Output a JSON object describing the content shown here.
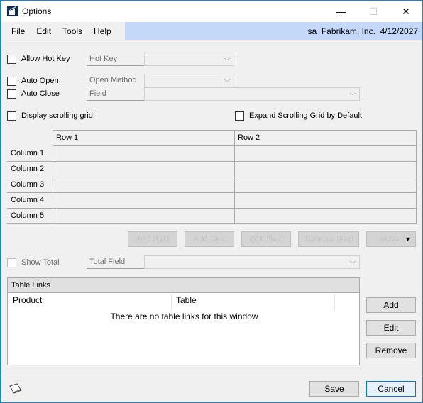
{
  "window": {
    "title": "Options",
    "icon": "chart-bar-icon",
    "controls": {
      "minimize": "—",
      "maximize": "☐",
      "close": "✕"
    }
  },
  "menubar": {
    "items": [
      "File",
      "Edit",
      "Tools",
      "Help"
    ],
    "user": "sa",
    "company": "Fabrikam, Inc.",
    "date": "4/12/2027",
    "status_text": "sa  Fabrikam, Inc.  4/12/2027"
  },
  "options": {
    "allow_hot_key": {
      "label": "Allow Hot Key",
      "checked": false
    },
    "hot_key": {
      "label": "Hot Key",
      "value": ""
    },
    "auto_open": {
      "label": "Auto Open",
      "checked": false
    },
    "open_method": {
      "label": "Open Method",
      "value": ""
    },
    "auto_close": {
      "label": "Auto Close",
      "checked": false
    },
    "field": {
      "label": "Field",
      "value": ""
    },
    "display_scrolling_grid": {
      "label": "Display scrolling grid",
      "checked": false
    },
    "expand_scrolling_grid": {
      "label": "Expand Scrolling Grid by Default",
      "checked": false
    }
  },
  "grid": {
    "row_headers": [
      "Row 1",
      "Row 2"
    ],
    "column_labels": [
      "Column 1",
      "Column 2",
      "Column 3",
      "Column 4",
      "Column 5"
    ]
  },
  "grid_buttons": {
    "add_field": "Add Field",
    "add_calc": "Add Calc",
    "edit_field": "Edit Field",
    "remove_field": "Remove Field",
    "move": "Move"
  },
  "total": {
    "show_total": {
      "label": "Show Total",
      "checked": false,
      "disabled": true
    },
    "total_field": {
      "label": "Total Field",
      "value": ""
    }
  },
  "table_links": {
    "title": "Table Links",
    "columns": [
      "Product",
      "Table"
    ],
    "empty_message": "There are no table links for this window",
    "buttons": {
      "add": "Add",
      "edit": "Edit",
      "remove": "Remove"
    }
  },
  "footer": {
    "note_icon": "note-icon",
    "save": "Save",
    "cancel": "Cancel"
  }
}
